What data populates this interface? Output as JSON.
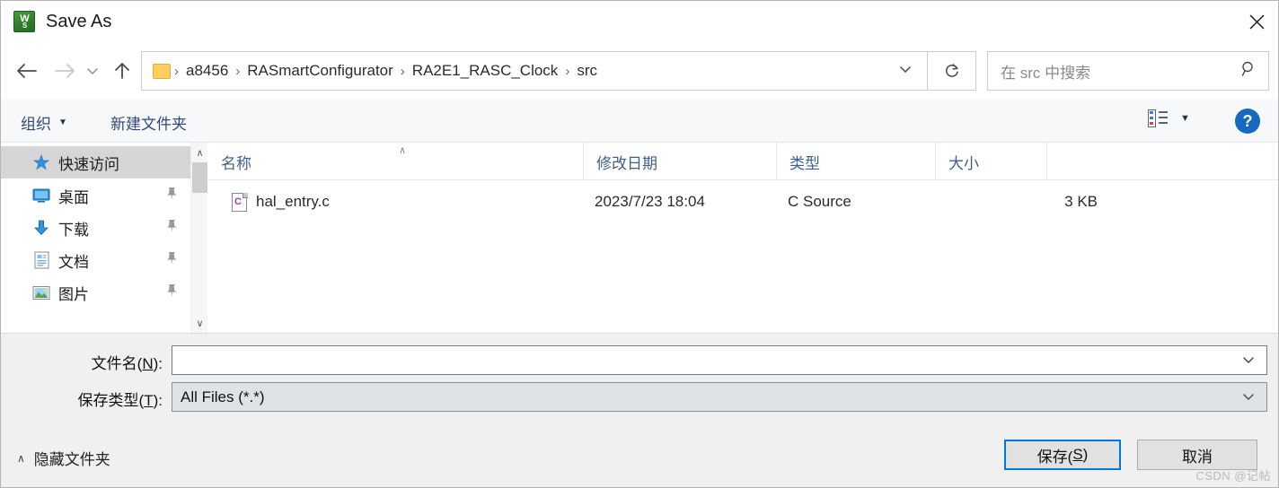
{
  "window": {
    "title": "Save As",
    "app_icon": "app-icon-green",
    "icon_glyph_top": "W",
    "icon_glyph_bottom": "S",
    "close_label": "✕"
  },
  "nav": {
    "back_icon": "back-arrow-icon",
    "forward_icon": "forward-arrow-icon",
    "recent_icon": "chevron-down-icon",
    "up_icon": "up-arrow-icon",
    "refresh_icon": "refresh-icon",
    "address_chevron": "chevron-down-icon",
    "separator": "›",
    "breadcrumbs": [
      "a8456",
      "RASmartConfigurator",
      "RA2E1_RASC_Clock",
      "src"
    ]
  },
  "search": {
    "placeholder": "在 src 中搜索",
    "icon": "search-icon"
  },
  "toolbar": {
    "organize_label": "组织",
    "organize_caret": "▼",
    "new_folder_label": "新建文件夹",
    "view_icon": "list-view-icon",
    "view_caret": "▼",
    "help_label": "?"
  },
  "sidebar": {
    "items": [
      {
        "label": "快速访问",
        "icon": "star-pin-icon",
        "selected": true,
        "pinned": false
      },
      {
        "label": "桌面",
        "icon": "desktop-icon",
        "selected": false,
        "pinned": true
      },
      {
        "label": "下载",
        "icon": "download-icon",
        "selected": false,
        "pinned": true
      },
      {
        "label": "文档",
        "icon": "documents-icon",
        "selected": false,
        "pinned": true
      },
      {
        "label": "图片",
        "icon": "pictures-icon",
        "selected": false,
        "pinned": true
      }
    ],
    "pin_glyph": "📌",
    "scroll_up": "∧",
    "scroll_down": "∨"
  },
  "filelist": {
    "columns": [
      {
        "label": "名称",
        "sorted": "asc"
      },
      {
        "label": "修改日期",
        "sorted": ""
      },
      {
        "label": "类型",
        "sorted": ""
      },
      {
        "label": "大小",
        "sorted": ""
      }
    ],
    "sort_caret": "∧",
    "rows": [
      {
        "icon": "c-source-file-icon",
        "icon_letter": "C",
        "name": "hal_entry.c",
        "modified": "2023/7/23 18:04",
        "type": "C Source",
        "size": "3 KB"
      }
    ]
  },
  "form": {
    "filename_label_pre": "文件名(",
    "filename_label_key": "N",
    "filename_label_post": "):",
    "filename_value": "",
    "filename_chevron": "chevron-down-icon",
    "filetype_label_pre": "保存类型(",
    "filetype_label_key": "T",
    "filetype_label_post": "):",
    "filetype_value": "All Files (*.*)",
    "filetype_chevron": "chevron-down-icon"
  },
  "footer": {
    "hide_folders_caret": "∧",
    "hide_folders_label": "隐藏文件夹",
    "save_label_pre": "保存(",
    "save_label_key": "S",
    "save_label_post": ")",
    "cancel_label": "取消"
  },
  "watermark": {
    "text": "CSDN @记帖"
  },
  "colors": {
    "accent": "#0078d7",
    "header_text": "#3e6090",
    "toolbar_text": "#2e4a78",
    "selection": "#d6d6d6",
    "dialog_bg": "#f0f0f0"
  }
}
